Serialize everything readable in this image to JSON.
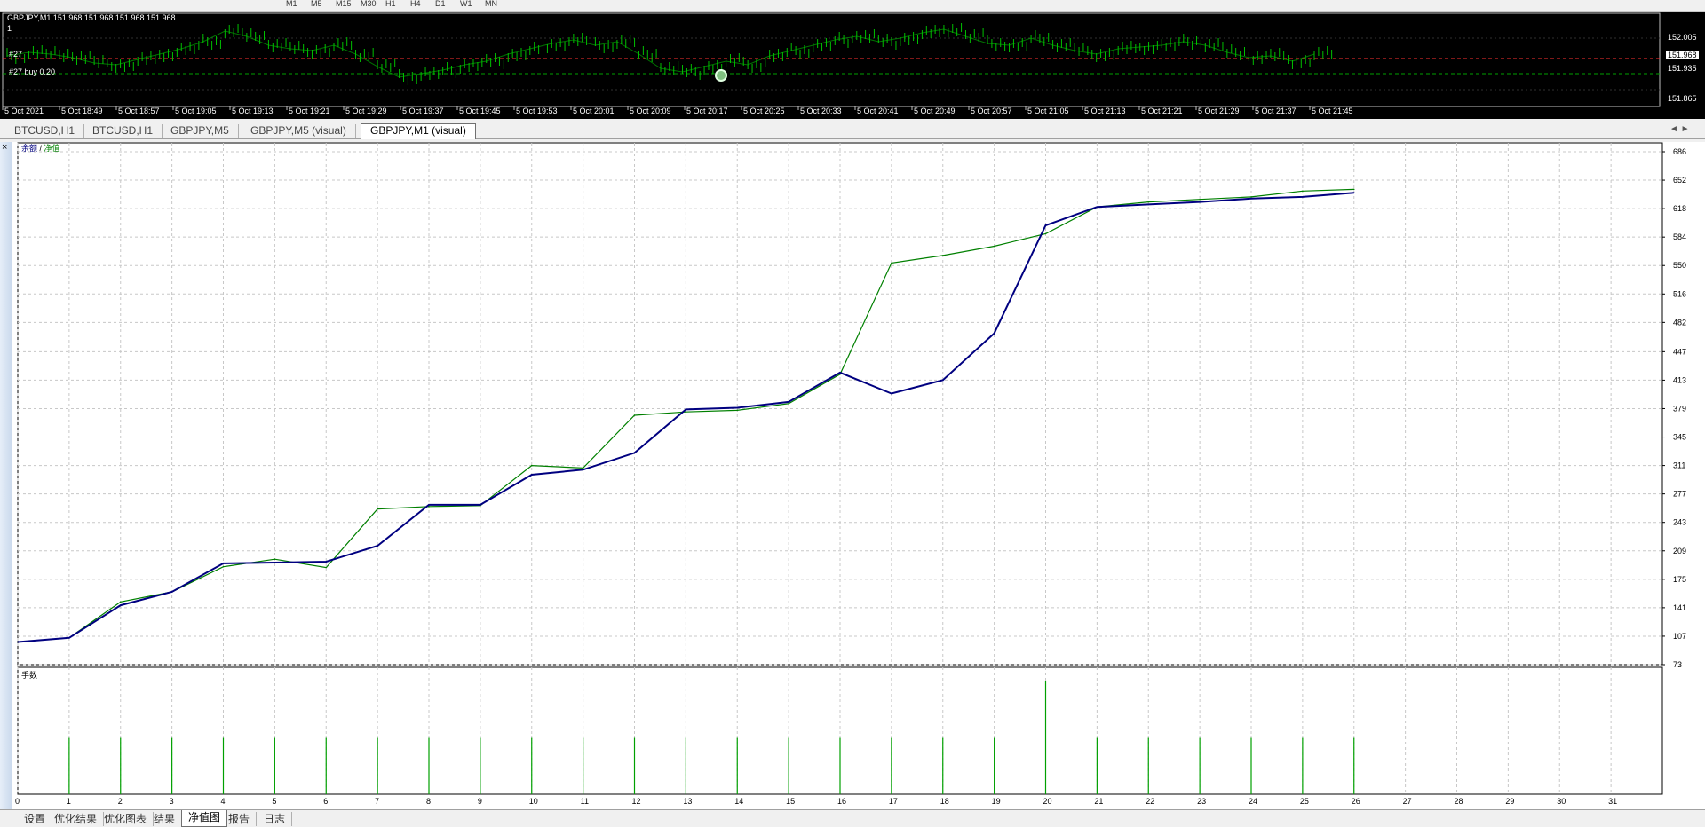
{
  "toolbar": {
    "period_buttons": [
      "M1",
      "M5",
      "M15",
      "M30",
      "H1",
      "H4",
      "D1",
      "W1",
      "MN"
    ]
  },
  "price_chart": {
    "title": "GBPJPY,M1  151.968 151.968 151.968 151.968",
    "indicator_value": "1",
    "order_label_1": "#27",
    "order_label_2": "#27 buy 0.20",
    "price_levels": [
      "152.005",
      "151.968",
      "151.935",
      "151.865"
    ],
    "current_price": "151.968",
    "time_labels": [
      "5 Oct 2021",
      "5 Oct 18:49",
      "5 Oct 18:57",
      "5 Oct 19:05",
      "5 Oct 19:13",
      "5 Oct 19:21",
      "5 Oct 19:29",
      "5 Oct 19:37",
      "5 Oct 19:45",
      "5 Oct 19:53",
      "5 Oct 20:01",
      "5 Oct 20:09",
      "5 Oct 20:17",
      "5 Oct 20:25",
      "5 Oct 20:33",
      "5 Oct 20:41",
      "5 Oct 20:49",
      "5 Oct 20:57",
      "5 Oct 21:05",
      "5 Oct 21:13",
      "5 Oct 21:21",
      "5 Oct 21:29",
      "5 Oct 21:37",
      "5 Oct 21:45"
    ],
    "colors": {
      "background": "#000000",
      "bars": "#00c000",
      "order_line": "#ff3030",
      "level_line": "#00a000"
    }
  },
  "chart_tabs": [
    {
      "label": "BTCUSD,H1",
      "active": false
    },
    {
      "label": "BTCUSD,H1",
      "active": false
    },
    {
      "label": "GBPJPY,M5",
      "active": false
    },
    {
      "label": "GBPJPY,M5 (visual)",
      "active": false
    },
    {
      "label": "GBPJPY,M1 (visual)",
      "active": true
    }
  ],
  "tab_nav": "◄ ►",
  "close_icon_text": "×",
  "chart_data": {
    "type": "line",
    "legend": {
      "balance_label": "余额",
      "separator": "/",
      "equity_label": "净值"
    },
    "x": [
      0,
      1,
      2,
      3,
      4,
      5,
      6,
      7,
      8,
      9,
      10,
      11,
      12,
      13,
      14,
      15,
      16,
      17,
      18,
      19,
      20,
      21,
      22,
      23,
      24,
      25,
      26
    ],
    "x_ticks": [
      "0",
      "1",
      "2",
      "3",
      "4",
      "5",
      "6",
      "7",
      "8",
      "9",
      "10",
      "11",
      "12",
      "13",
      "14",
      "15",
      "16",
      "17",
      "18",
      "19",
      "20",
      "21",
      "22",
      "23",
      "24",
      "25",
      "26",
      "27",
      "28",
      "29",
      "30",
      "31"
    ],
    "y_ticks": [
      "686",
      "652",
      "618",
      "584",
      "550",
      "516",
      "482",
      "447",
      "413",
      "379",
      "345",
      "311",
      "277",
      "243",
      "209",
      "175",
      "141",
      "107",
      "73"
    ],
    "ylim": [
      73,
      686
    ],
    "xlim": [
      0,
      32
    ],
    "series": [
      {
        "name": "余额",
        "color": "#000080",
        "values": [
          100,
          105,
          144,
          160,
          194,
          195,
          196,
          215,
          264,
          264,
          300,
          306,
          326,
          378,
          380,
          387,
          422,
          397,
          413,
          469,
          598,
          620,
          623,
          626,
          630,
          632,
          637
        ]
      },
      {
        "name": "净值",
        "color": "#008000",
        "values": [
          100,
          105,
          148,
          160,
          190,
          199,
          189,
          259,
          262,
          263,
          311,
          308,
          371,
          375,
          377,
          385,
          420,
          553,
          562,
          573,
          588,
          620,
          626,
          629,
          632,
          639,
          641
        ]
      }
    ],
    "volume_panel": {
      "label": "手数",
      "values": [
        0,
        0.2,
        0.2,
        0.2,
        0.2,
        0.2,
        0.2,
        0.2,
        0.2,
        0.2,
        0.2,
        0.2,
        0.2,
        0.2,
        0.2,
        0.2,
        0.2,
        0.2,
        0.2,
        0.2,
        0.4,
        0.2,
        0.2,
        0.2,
        0.2,
        0.2,
        0.2
      ],
      "bar_color": "#00a000"
    },
    "grid": true
  },
  "bottom_tabs": [
    {
      "label": "设置",
      "active": false
    },
    {
      "label": "优化结果",
      "active": false
    },
    {
      "label": "优化图表",
      "active": false
    },
    {
      "label": "结果",
      "active": false
    },
    {
      "label": "净值图",
      "active": true
    },
    {
      "label": "报告",
      "active": false
    },
    {
      "label": "日志",
      "active": false
    }
  ]
}
